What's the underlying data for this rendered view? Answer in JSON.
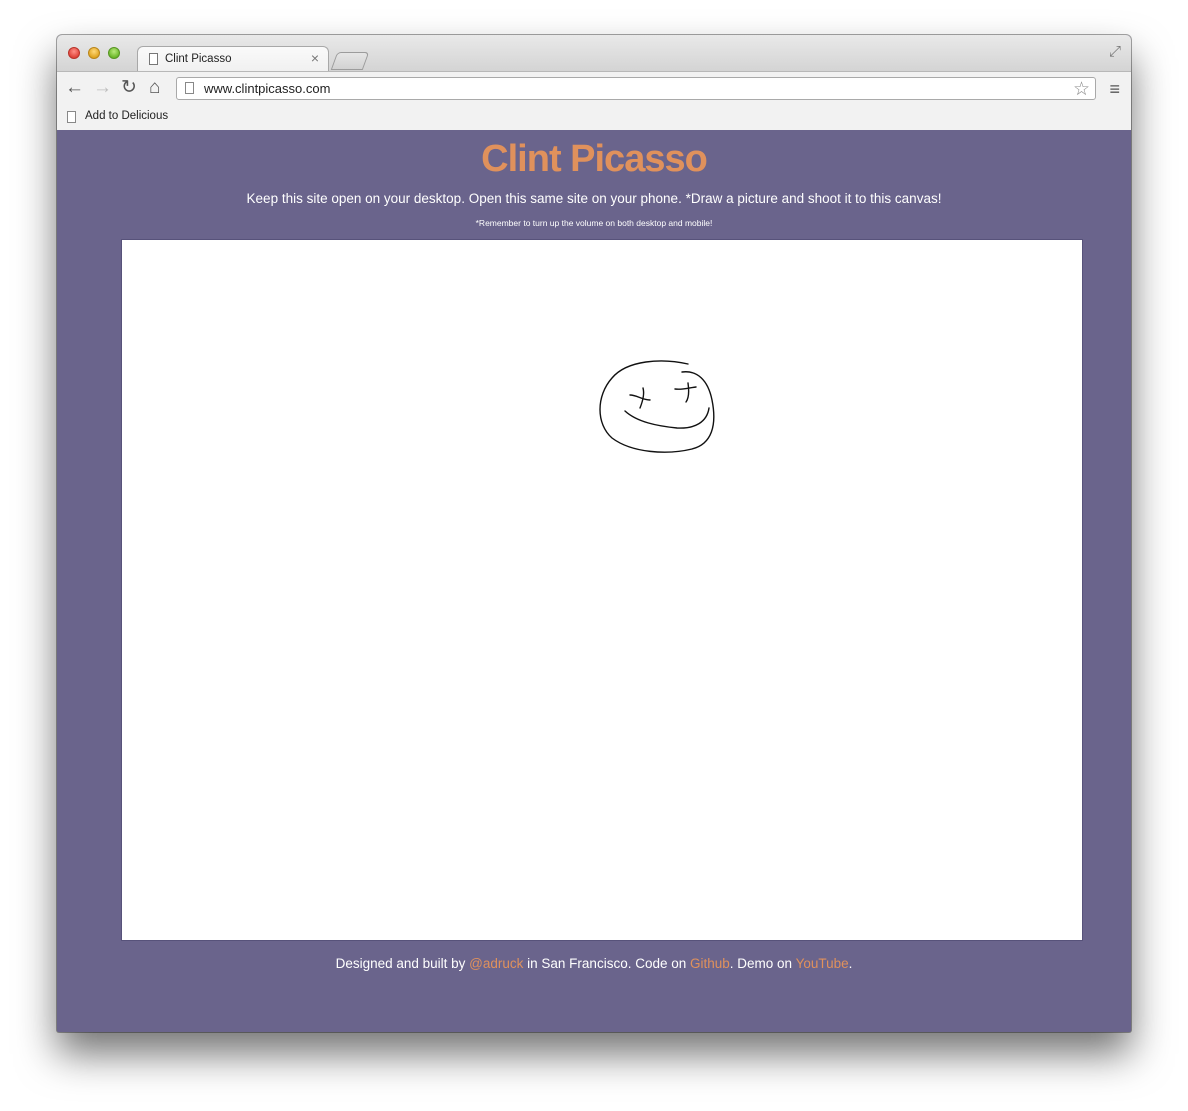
{
  "browser": {
    "tab_title": "Clint Picasso",
    "url": "www.clintpicasso.com",
    "bookmark_label": "Add to Delicious",
    "icons": {
      "back": "back-arrow-icon",
      "forward": "forward-arrow-icon",
      "reload": "reload-icon",
      "home": "home-icon",
      "star": "star-icon",
      "menu": "menu-icon",
      "close": "close-icon",
      "fullscreen": "fullscreen-icon"
    }
  },
  "page": {
    "title": "Clint Picasso",
    "tagline": "Keep this site open on your desktop. Open this same site on your phone. *Draw a picture and shoot it to this canvas!",
    "reminder": "*Remember to turn up the volume on both desktop and mobile!",
    "footer": {
      "prefix": "Designed and built by ",
      "author_link": "@adruck",
      "middle": " in San Francisco. Code on ",
      "code_link": "Github",
      "demo_text": ". Demo on ",
      "demo_link": "YouTube",
      "suffix": "."
    }
  },
  "colors": {
    "page_bg": "#6a648c",
    "accent": "#e0915c",
    "text": "#ffffff"
  }
}
